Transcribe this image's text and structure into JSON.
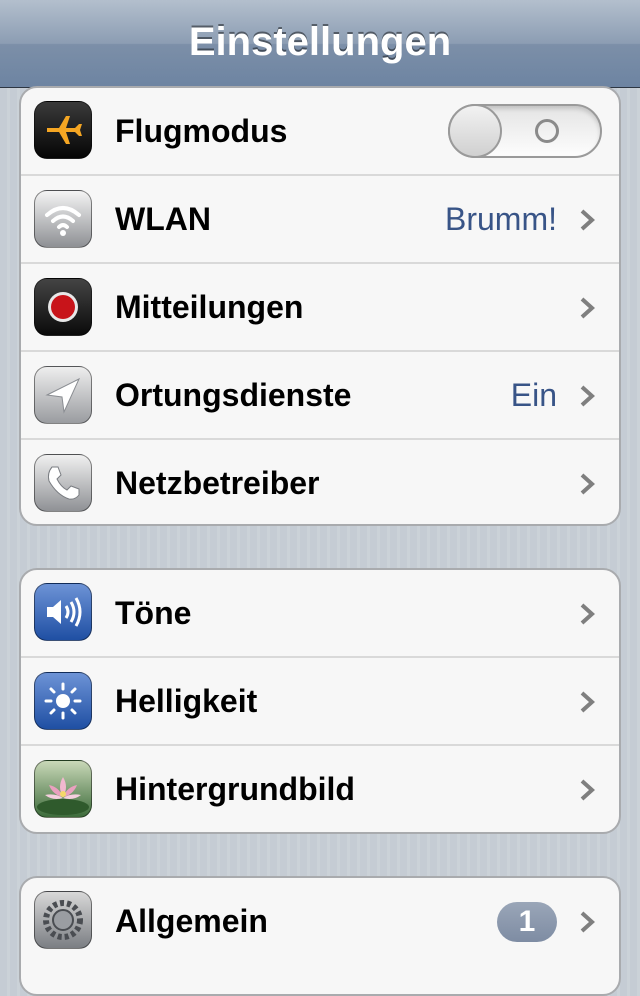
{
  "navbar": {
    "title": "Einstellungen"
  },
  "groups": [
    {
      "items": [
        {
          "label": "Flugmodus",
          "icon": "airplane-icon",
          "toggle": "off"
        },
        {
          "label": "WLAN",
          "icon": "wifi-icon",
          "value": "Brumm!"
        },
        {
          "label": "Mitteilungen",
          "icon": "notifications-icon"
        },
        {
          "label": "Ortungsdienste",
          "icon": "location-arrow-icon",
          "value": "Ein"
        },
        {
          "label": "Netzbetreiber",
          "icon": "phone-icon"
        }
      ]
    },
    {
      "items": [
        {
          "label": "Töne",
          "icon": "speaker-icon"
        },
        {
          "label": "Helligkeit",
          "icon": "brightness-icon"
        },
        {
          "label": "Hintergrundbild",
          "icon": "wallpaper-flower-icon"
        }
      ]
    },
    {
      "items": [
        {
          "label": "Allgemein",
          "icon": "gear-icon",
          "badge": "1"
        }
      ]
    }
  ],
  "colors": {
    "value_text": "#385487",
    "navbar_gradient_top": "#b3bfcd",
    "navbar_gradient_bottom": "#6d84a2",
    "group_background": "#f7f7f7",
    "page_background": "#c5ccd4"
  }
}
